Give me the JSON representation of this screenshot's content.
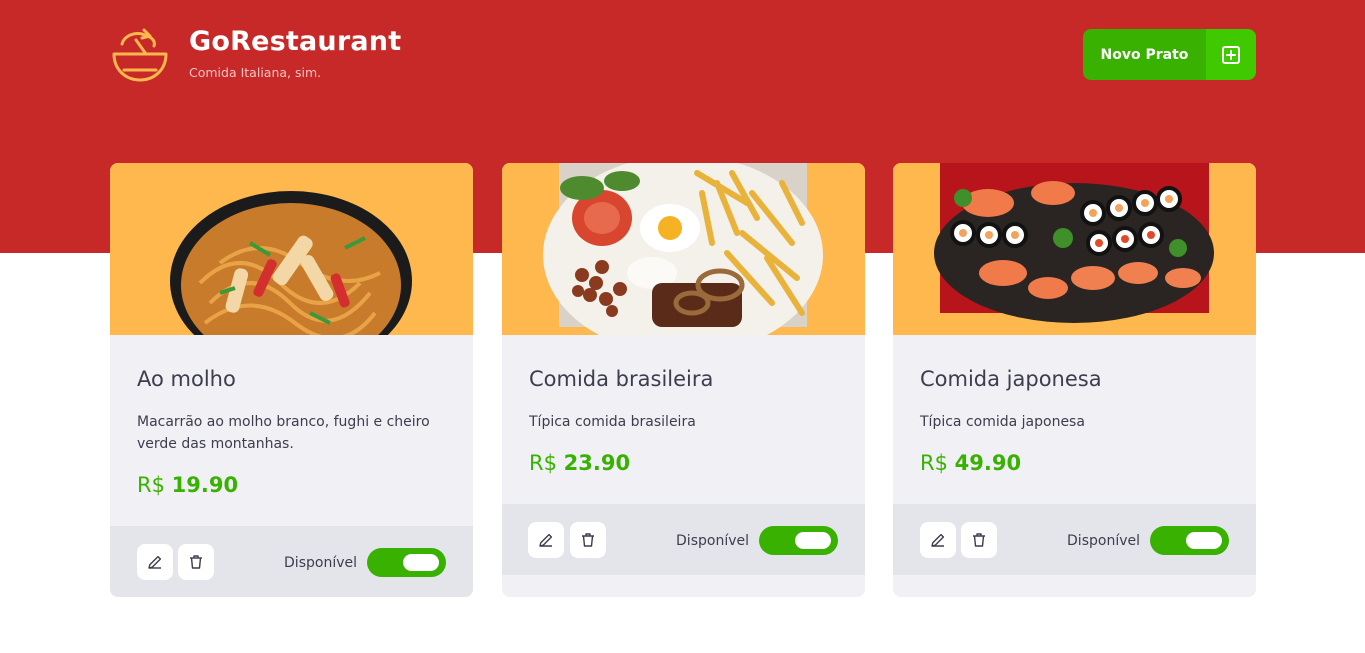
{
  "header": {
    "logo_icon": "food-bowl-icon",
    "app_name": "GoRestaurant",
    "tagline": "Comida Italiana, sim.",
    "new_dish_label": "Novo Prato",
    "new_dish_icon": "plus-square-icon"
  },
  "colors": {
    "hero": "#c72828",
    "accent": "#39b100",
    "accent_light": "#41c900",
    "card_image_bg": "#ffb84d",
    "card_bg": "#f0f0f5",
    "card_footer_bg": "#e4e4eb",
    "text": "#3d3d4d"
  },
  "dishes": [
    {
      "name": "Ao molho",
      "description": "Macarrão ao molho branco, fughi e cheiro verde das montanhas.",
      "currency": "R$",
      "price": "19.90",
      "available_label": "Disponível",
      "available": true,
      "image": "noodle-bowl-photo",
      "edit_icon": "pencil-icon",
      "delete_icon": "trash-icon"
    },
    {
      "name": "Comida brasileira",
      "description": "Típica comida brasileira",
      "currency": "R$",
      "price": "23.90",
      "available_label": "Disponível",
      "available": true,
      "image": "brazilian-plate-photo",
      "edit_icon": "pencil-icon",
      "delete_icon": "trash-icon"
    },
    {
      "name": "Comida japonesa",
      "description": "Típica comida japonesa",
      "currency": "R$",
      "price": "49.90",
      "available_label": "Disponível",
      "available": true,
      "image": "sushi-platter-photo",
      "edit_icon": "pencil-icon",
      "delete_icon": "trash-icon"
    }
  ]
}
